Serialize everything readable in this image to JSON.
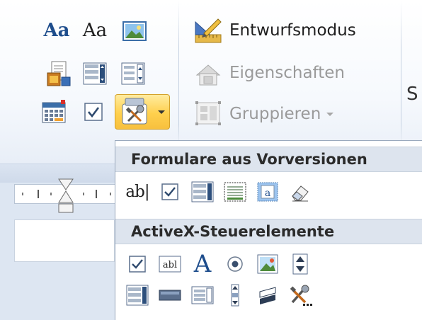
{
  "ribbon": {
    "aa_bold": "Aa",
    "aa_plain": "Aa",
    "design_mode": "Entwurfsmodus",
    "properties": "Eigenschaften",
    "group": "Gruppieren",
    "cut_label": "S"
  },
  "menu": {
    "legacy_header": "Formulare aus Vorversionen",
    "legacy_text_field": "ab|",
    "activex_header": "ActiveX-Steuerelemente",
    "activex_textbox_label": "abl",
    "activex_label_glyph": "A",
    "activex_image_char": "a"
  },
  "colors": {
    "highlight": "#ffd04d",
    "accent_blue": "#1e4d8c",
    "menu_header_bg": "#dde4ee"
  }
}
